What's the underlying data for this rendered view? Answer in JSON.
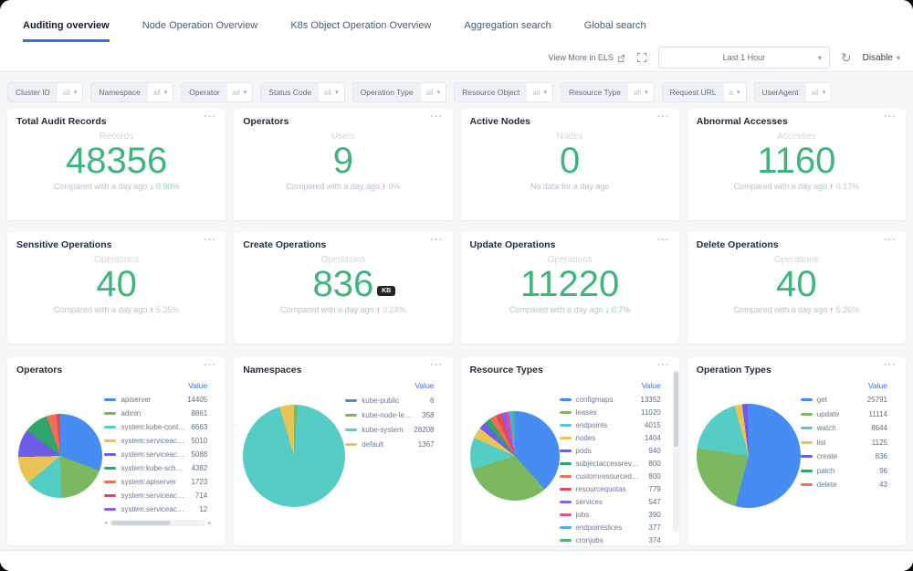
{
  "tabs": [
    {
      "label": "Auditing overview",
      "active": true
    },
    {
      "label": "Node Operation Overview",
      "active": false
    },
    {
      "label": "K8s Object Operation Overview",
      "active": false
    },
    {
      "label": "Aggregation search",
      "active": false
    },
    {
      "label": "Global search",
      "active": false
    }
  ],
  "toolbar": {
    "view_more": "View More in ELS",
    "time_range": "Last 1 Hour",
    "disable_label": "Disable"
  },
  "icons": {
    "caret": "▾",
    "menu": "···",
    "refresh": "↻",
    "scroll_left": "◂",
    "scroll_right": "▸"
  },
  "filters": [
    {
      "label": "Cluster ID",
      "value": "all"
    },
    {
      "label": "Namespace",
      "value": "all"
    },
    {
      "label": "Operator",
      "value": "all"
    },
    {
      "label": "Status Code",
      "value": "all"
    },
    {
      "label": "Operation Type",
      "value": "all"
    },
    {
      "label": "Resource Object",
      "value": "all"
    },
    {
      "label": "Resource Type",
      "value": "all"
    },
    {
      "label": "Request URL",
      "value": "a"
    },
    {
      "label": "UserAgent",
      "value": "all"
    }
  ],
  "stat_rows": [
    [
      {
        "title": "Total Audit Records",
        "unit": "Records",
        "value": "48356",
        "compare_text": "Compared with a day ago",
        "trend": "down",
        "arrow": "↓",
        "percent": "0.90%",
        "badge": ""
      },
      {
        "title": "Operators",
        "unit": "Users",
        "value": "9",
        "compare_text": "Compared with a day ago",
        "trend": "up",
        "arrow": "↑",
        "percent": "0%",
        "badge": ""
      },
      {
        "title": "Active Nodes",
        "unit": "Nodes",
        "value": "0",
        "compare_text": "No data for a day ago",
        "trend": "",
        "arrow": "",
        "percent": "",
        "badge": ""
      },
      {
        "title": "Abnormal Accesses",
        "unit": "Accesses",
        "value": "1160",
        "compare_text": "Compared with a day ago",
        "trend": "up",
        "arrow": "↑",
        "percent": "0.17%",
        "badge": ""
      }
    ],
    [
      {
        "title": "Sensitive Operations",
        "unit": "Operations",
        "value": "40",
        "compare_text": "Compared with a day ago",
        "trend": "up",
        "arrow": "↑",
        "percent": "5.35%",
        "badge": ""
      },
      {
        "title": "Create Operations",
        "unit": "Operations",
        "value": "836",
        "compare_text": "Compared with a day ago",
        "trend": "up",
        "arrow": "↑",
        "percent": "0.24%",
        "badge": "KB"
      },
      {
        "title": "Update Operations",
        "unit": "Operations",
        "value": "11220",
        "compare_text": "Compared with a day ago",
        "trend": "down",
        "arrow": "↓",
        "percent": "0.7%",
        "badge": ""
      },
      {
        "title": "Delete Operations",
        "unit": "Operations",
        "value": "40",
        "compare_text": "Compared with a day ago",
        "trend": "up",
        "arrow": "↑",
        "percent": "5.26%",
        "badge": ""
      }
    ]
  ],
  "chart_data": [
    {
      "type": "pie",
      "title": "Operators",
      "legend_header": "Value",
      "legend_position": "right",
      "labels": [
        "apiserver",
        "admin",
        "system:kube-controller-...",
        "system:serviceaccount:ku...",
        "system:serviceaccount:ku...",
        "system:kube-scheduler",
        "system:apiserver",
        "system:serviceaccount:ku...",
        "system:serviceaccount:ku..."
      ],
      "values": [
        14405,
        8861,
        6663,
        5010,
        5088,
        4382,
        1723,
        714,
        12
      ],
      "colors": [
        "#478cf3",
        "#7cb860",
        "#55cdc4",
        "#e9c356",
        "#6e5be8",
        "#2fa56c",
        "#f56e4f",
        "#e3455a",
        "#8b5cf6"
      ],
      "has_hscroll": true,
      "has_vscroll": false
    },
    {
      "type": "pie",
      "title": "Namespaces",
      "legend_header": "Value",
      "legend_position": "right",
      "labels": [
        "kube-public",
        "kube-node-lease",
        "kube-system",
        "default"
      ],
      "values": [
        6,
        358,
        28208,
        1367
      ],
      "colors": [
        "#478cf3",
        "#7cb860",
        "#55cdc4",
        "#e9c356"
      ],
      "has_hscroll": false,
      "has_vscroll": false
    },
    {
      "type": "pie",
      "title": "Resource Types",
      "legend_header": "Value",
      "legend_position": "right",
      "labels": [
        "configmaps",
        "leases",
        "endpoints",
        "nodes",
        "pods",
        "subjectaccessreviews",
        "customresourcedefinit...",
        "resourcequotas",
        "services",
        "jobs",
        "endpointslices",
        "cronjobs"
      ],
      "values": [
        13352,
        11020,
        4015,
        1404,
        940,
        800,
        800,
        779,
        547,
        390,
        377,
        374
      ],
      "colors": [
        "#478cf3",
        "#7cb860",
        "#55cdc4",
        "#e9c356",
        "#6e5be8",
        "#2fa56c",
        "#f56e4f",
        "#e3455a",
        "#8b5cf6",
        "#e8517e",
        "#54a9f5",
        "#46b97c"
      ],
      "has_hscroll": true,
      "has_vscroll": true
    },
    {
      "type": "pie",
      "title": "Operation Types",
      "legend_header": "Value",
      "legend_position": "right",
      "labels": [
        "get",
        "update",
        "watch",
        "list",
        "create",
        "patch",
        "delete"
      ],
      "values": [
        25791,
        11114,
        8644,
        1125,
        836,
        96,
        43
      ],
      "colors": [
        "#478cf3",
        "#7cb860",
        "#55cdc4",
        "#e9c356",
        "#6e5be8",
        "#2fa56c",
        "#f56e4f"
      ],
      "has_hscroll": false,
      "has_vscroll": false
    }
  ],
  "colors": {
    "accent_blue": "#3a6cfb",
    "stat_green": "#3fb57d",
    "trend_red": "#d0483f",
    "value_header_blue": "#3a6cfb"
  }
}
